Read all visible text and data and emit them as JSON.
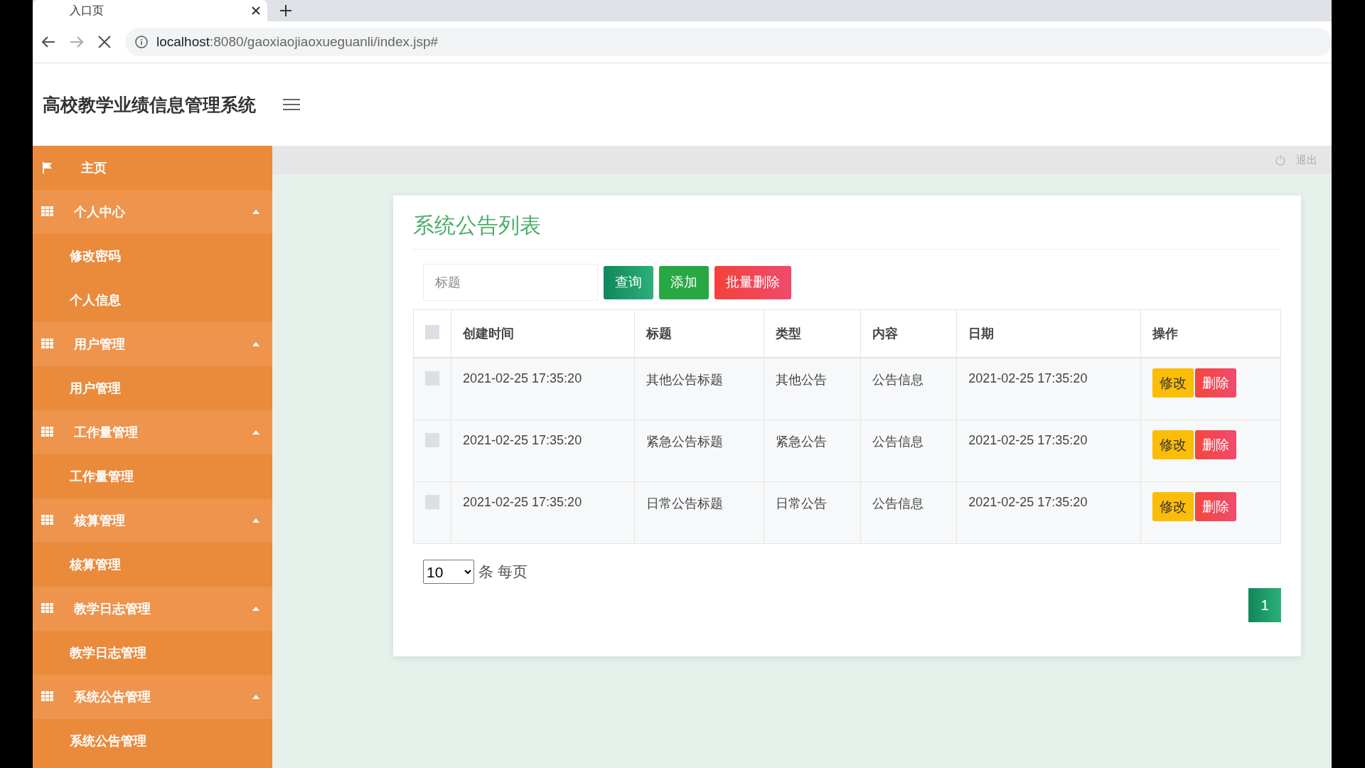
{
  "browser": {
    "tab_title": "入口页",
    "url_host": "localhost",
    "url_rest": ":8080/gaoxiaojiaoxueguanli/index.jsp#"
  },
  "header": {
    "title": "高校教学业绩信息管理系统"
  },
  "sidebar": {
    "items": [
      {
        "kind": "home",
        "label": "主页"
      },
      {
        "kind": "group",
        "label": "个人中心",
        "expanded": true,
        "children": [
          {
            "label": "修改密码"
          },
          {
            "label": "个人信息"
          }
        ]
      },
      {
        "kind": "group",
        "label": "用户管理",
        "expanded": true,
        "children": [
          {
            "label": "用户管理"
          }
        ]
      },
      {
        "kind": "group",
        "label": "工作量管理",
        "expanded": true,
        "children": [
          {
            "label": "工作量管理"
          }
        ]
      },
      {
        "kind": "group",
        "label": "核算管理",
        "expanded": true,
        "children": [
          {
            "label": "核算管理"
          }
        ]
      },
      {
        "kind": "group",
        "label": "教学日志管理",
        "expanded": true,
        "children": [
          {
            "label": "教学日志管理"
          }
        ]
      },
      {
        "kind": "group",
        "label": "系统公告管理",
        "expanded": true,
        "children": [
          {
            "label": "系统公告管理"
          }
        ]
      }
    ]
  },
  "topbar": {
    "logout": "退出"
  },
  "card": {
    "title": "系统公告列表",
    "search": {
      "placeholder": "标题"
    },
    "buttons": [
      {
        "kind": "query",
        "label": "查询"
      },
      {
        "kind": "add",
        "label": "添加"
      },
      {
        "kind": "delete",
        "label": "批量删除"
      }
    ],
    "table": {
      "columns": [
        "创建时间",
        "标题",
        "类型",
        "内容",
        "日期",
        "操作"
      ],
      "header_checked": false,
      "rows": [
        {
          "checked": false,
          "cells": [
            "2021-02-25 17:35:20",
            "其他公告标题",
            "其他公告",
            "公告信息",
            "2021-02-25 17:35:20"
          ],
          "actions": [
            "修改",
            "删除"
          ]
        },
        {
          "checked": false,
          "cells": [
            "2021-02-25 17:35:20",
            "紧急公告标题",
            "紧急公告",
            "公告信息",
            "2021-02-25 17:35:20"
          ],
          "actions": [
            "修改",
            "删除"
          ]
        },
        {
          "checked": false,
          "cells": [
            "2021-02-25 17:35:20",
            "日常公告标题",
            "日常公告",
            "公告信息",
            "2021-02-25 17:35:20"
          ],
          "actions": [
            "修改",
            "删除"
          ]
        }
      ]
    },
    "page_size": "10",
    "page_size_label": "条 每页",
    "pages": [
      {
        "label": "1",
        "selected": true
      }
    ]
  }
}
